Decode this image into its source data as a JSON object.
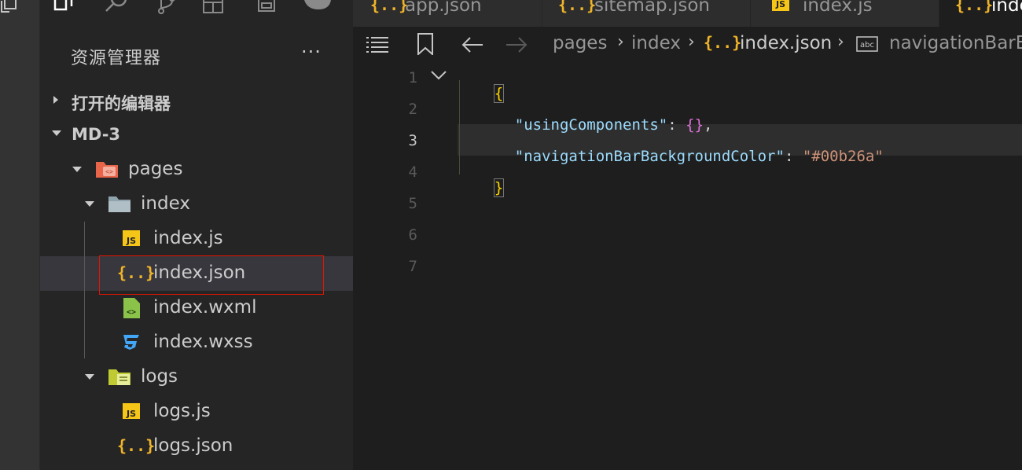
{
  "colors": {
    "accent_json": "#f0b429",
    "js_badge": "#f5c518",
    "error_border": "#e51400"
  },
  "activity_icons": [
    "files-icon",
    "search-icon",
    "source-control-icon",
    "extensions-icon",
    "debug-icon",
    "cloud-icon"
  ],
  "sidebar": {
    "title": "资源管理器",
    "more": "···",
    "sections": [
      {
        "label": "打开的编辑器",
        "expanded": false
      },
      {
        "label": "MD-3",
        "expanded": true
      }
    ],
    "tree": [
      {
        "label": "pages",
        "icon": "folder-pages-icon"
      },
      {
        "label": "index",
        "icon": "folder-icon"
      },
      {
        "label": "index.js",
        "icon": "js-file-icon"
      },
      {
        "label": "index.json",
        "icon": "json-file-icon"
      },
      {
        "label": "index.wxml",
        "icon": "wxml-file-icon"
      },
      {
        "label": "index.wxss",
        "icon": "css-file-icon"
      },
      {
        "label": "logs",
        "icon": "folder-logs-icon"
      },
      {
        "label": "logs.js",
        "icon": "js-file-icon"
      },
      {
        "label": "logs.json",
        "icon": "json-file-icon"
      }
    ]
  },
  "tabs": [
    {
      "label": "app.json",
      "icon": "json-file-icon"
    },
    {
      "label": "sitemap.json",
      "icon": "json-file-icon"
    },
    {
      "label": "index.js",
      "icon": "js-file-icon"
    },
    {
      "label": "inde",
      "icon": "json-file-icon"
    }
  ],
  "breadcrumb": [
    "pages",
    "index",
    "index.json",
    "navigationBarB"
  ],
  "editor": {
    "line_numbers": [
      "1",
      "2",
      "3",
      "4",
      "5",
      "6",
      "7"
    ],
    "current_line": "3",
    "code": {
      "open_brace": "{",
      "key1": "\"usingComponents\"",
      "colon": ": ",
      "val1": "{}",
      "comma": ",",
      "key2": "\"navigationBarBackgroundColor\"",
      "val2": "\"#00b26a\"",
      "close_brace": "}"
    }
  }
}
